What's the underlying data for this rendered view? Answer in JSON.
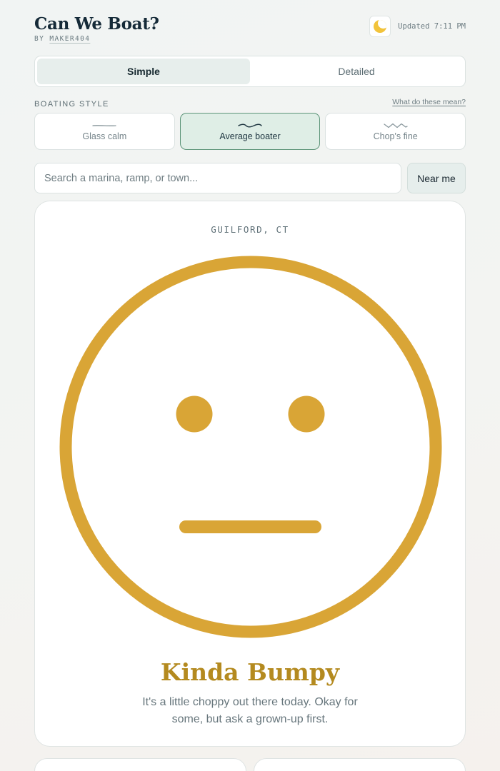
{
  "app": {
    "title": "Can We Boat?",
    "byline_prefix": "BY",
    "author": "MAKER404",
    "updated": "Updated 7:11 PM"
  },
  "icons": {
    "theme_toggle": "moon-icon"
  },
  "view_tabs": [
    {
      "label": "Simple",
      "active": true
    },
    {
      "label": "Detailed",
      "active": false
    }
  ],
  "boating_style": {
    "label": "BOATING STYLE",
    "help_link": "What do these mean?",
    "options": [
      {
        "label": "Glass calm",
        "icon": "flat-wave-icon",
        "active": false
      },
      {
        "label": "Average boater",
        "icon": "gentle-wave-icon",
        "active": true
      },
      {
        "label": "Chop's fine",
        "icon": "choppy-wave-icon",
        "active": false
      }
    ]
  },
  "search": {
    "placeholder": "Search a marina, ramp, or town...",
    "value": "",
    "near_me_label": "Near me"
  },
  "condition": {
    "location": "GUILFORD, CT",
    "face": "neutral-face-icon",
    "verdict": "Kinda Bumpy",
    "description": "It's a little choppy out there today. Okay for some, but ask a grown-up first.",
    "color": "#d9a536",
    "verdict_color": "#b48a1f"
  },
  "colors": {
    "accent": "#5c9478",
    "active_bg": "#dfeee6",
    "text": "#1c2a33"
  }
}
